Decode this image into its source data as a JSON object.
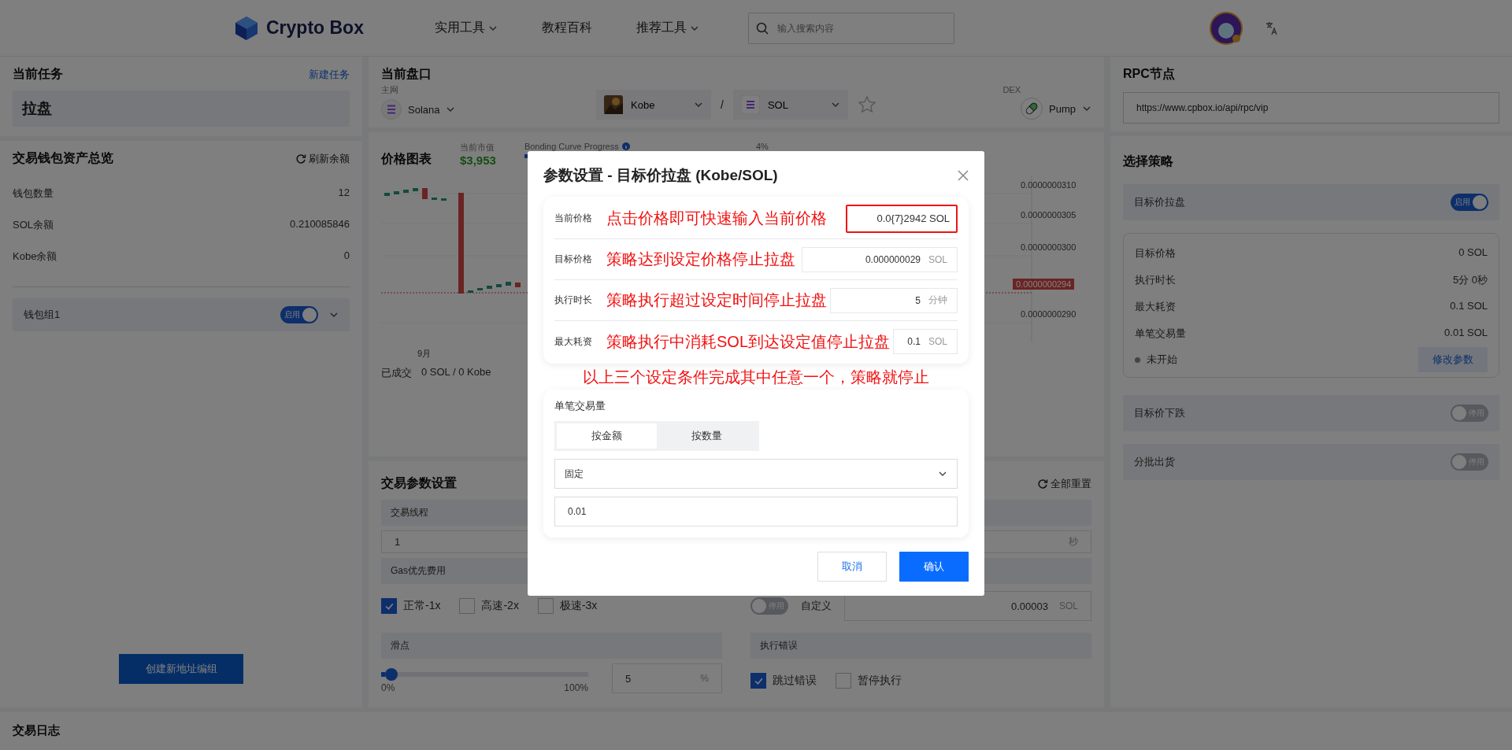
{
  "header": {
    "logo": "Crypto Box",
    "nav": [
      {
        "label": "实用工具",
        "dropdown": true
      },
      {
        "label": "教程百科",
        "dropdown": false
      },
      {
        "label": "推荐工具",
        "dropdown": true
      }
    ],
    "search": {
      "placeholder": "输入搜索内容"
    }
  },
  "current_task": {
    "title": "当前任务",
    "link": "新建任务",
    "task": "拉盘"
  },
  "wallet_overview": {
    "title": "交易钱包资产总览",
    "refresh": "刷新余额",
    "stats": [
      {
        "label": "钱包数量",
        "value": "12"
      },
      {
        "label": "SOL余额",
        "value": "0.210085846"
      },
      {
        "label": "Kobe余额",
        "value": "0"
      }
    ],
    "groups": [
      {
        "name": "钱包组1",
        "on": true,
        "toggle_label": "启用"
      }
    ],
    "create_button": "创建新地址编组"
  },
  "market": {
    "title": "当前盘口",
    "network_label": "主网",
    "network": "Solana",
    "base": "Kobe",
    "separator": "/",
    "quote": "SOL",
    "dex_label": "DEX",
    "dex": "Pump"
  },
  "price_chart": {
    "title": "价格图表",
    "market_cap_label": "当前市值",
    "market_cap": "$3,953",
    "progress_label": "Bonding Curve Progress",
    "progress_value": "4%",
    "progress": {
      "level": 0.04
    },
    "price_axis": [
      "0.0000000310",
      "0.0000000305",
      "0.0000000300",
      "0.0000000290"
    ],
    "current_price_tag": "0.0000000294",
    "month_label": "9月",
    "filled_label": "已成交",
    "filled_value": "0 SOL / 0 Kobe"
  },
  "trade_params": {
    "title": "交易参数设置",
    "reset": "全部重置",
    "threads_label": "交易线程",
    "threads_value": "1",
    "interval_unit": "秒",
    "gas_label": "Gas优先费用",
    "gas_options": [
      {
        "label": "正常-1x",
        "checked": true
      },
      {
        "label": "高速-2x",
        "checked": false
      },
      {
        "label": "极速-3x",
        "checked": false
      }
    ],
    "custom_gas": {
      "on": false,
      "toggle_label": "停用",
      "label": "自定义",
      "value": "0.00003",
      "unit": "SOL"
    },
    "slippage_label": "滑点",
    "slippage": {
      "level": 0.05,
      "min": "0%",
      "max": "100%",
      "value": "5",
      "unit": "%"
    },
    "error_label": "执行错误",
    "error_options": [
      {
        "label": "跳过错误",
        "checked": true
      },
      {
        "label": "暂停执行",
        "checked": false
      }
    ]
  },
  "rpc": {
    "title": "RPC节点",
    "value": "https://www.cpbox.io/api/rpc/vip"
  },
  "strategies": {
    "title": "选择策略",
    "items": [
      {
        "name": "目标价拉盘",
        "on": true,
        "toggle_label": "启用",
        "details": [
          {
            "label": "目标价格",
            "value": "0 SOL"
          },
          {
            "label": "执行时长",
            "value": "5分 0秒"
          },
          {
            "label": "最大耗资",
            "value": "0.1 SOL"
          },
          {
            "label": "单笔交易量",
            "value": "0.01 SOL"
          }
        ],
        "status": "未开始",
        "edit_button": "修改参数"
      },
      {
        "name": "目标价下跌",
        "on": false,
        "toggle_label": "停用"
      },
      {
        "name": "分批出货",
        "on": false,
        "toggle_label": "停用"
      }
    ]
  },
  "log": {
    "title": "交易日志"
  },
  "modal": {
    "title": "参数设置 - 目标价拉盘 (Kobe/SOL)",
    "conditions": [
      {
        "label": "当前价格",
        "kind": "display",
        "value": "0.0{7}2942 SOL",
        "annotation": "点击价格即可快速输入当前价格",
        "highlighted": true
      },
      {
        "label": "目标价格",
        "kind": "input",
        "value": "0.000000029",
        "unit": "SOL",
        "annotation": "策略达到设定价格停止拉盘",
        "highlighted": false
      },
      {
        "label": "执行时长",
        "kind": "input",
        "value": "5",
        "unit": "分钟",
        "annotation": "策略执行超过设定时间停止拉盘",
        "highlighted": false
      },
      {
        "label": "最大耗资",
        "kind": "input",
        "value": "0.1",
        "unit": "SOL",
        "annotation": "策略执行中消耗SOL到达设定值停止拉盘",
        "highlighted": false
      }
    ],
    "note": "以上三个设定条件完成其中任意一个，策略就停止",
    "amount_label": "单笔交易量",
    "amount_tabs": [
      {
        "label": "按金额",
        "selected": true
      },
      {
        "label": "按数量",
        "selected": false
      }
    ],
    "mode": "固定",
    "amount": "0.01",
    "buttons": [
      {
        "label": "取消",
        "kind": "secondary"
      },
      {
        "label": "确认",
        "kind": "primary"
      }
    ]
  }
}
